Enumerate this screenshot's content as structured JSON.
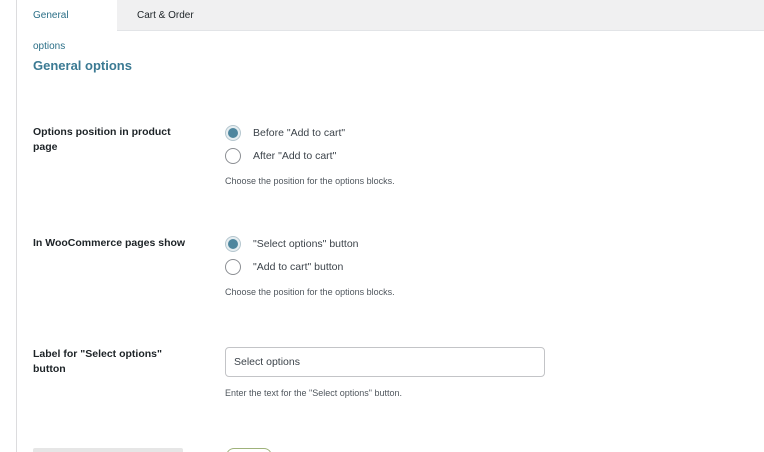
{
  "tabs": [
    {
      "label": "General options",
      "active": true
    },
    {
      "label": "Cart & Order",
      "active": false
    }
  ],
  "section": {
    "title": "General options"
  },
  "options_position": {
    "label": "Options position in product page",
    "choices": [
      {
        "label": "Before \"Add to cart\"",
        "checked": true
      },
      {
        "label": "After \"Add to cart\"",
        "checked": false
      }
    ],
    "description": "Choose the position for the options blocks."
  },
  "woocommerce_show": {
    "label": "In WooCommerce pages show",
    "choices": [
      {
        "label": "\"Select options\" button",
        "checked": true
      },
      {
        "label": "\"Add to cart\" button",
        "checked": false
      }
    ],
    "description": "Choose the position for the options blocks."
  },
  "select_options_label": {
    "label": "Label for \"Select options\" button",
    "value": "Select options",
    "description": "Enter the text for the \"Select options\" button."
  },
  "colors": {
    "accent": "#3b7a93",
    "radio_dot": "#4e869e"
  }
}
